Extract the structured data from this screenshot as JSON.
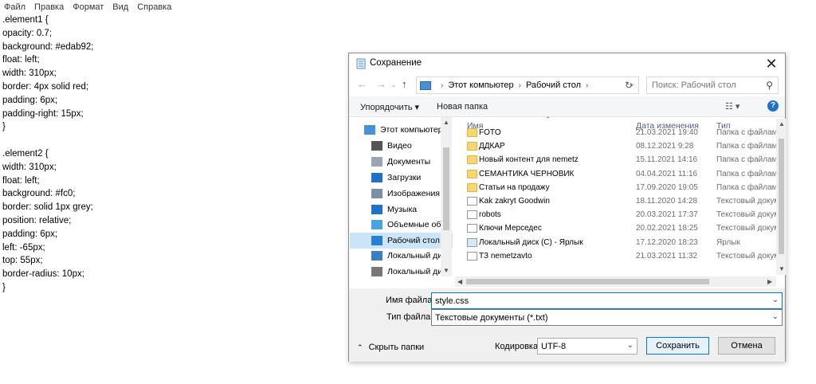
{
  "menubar": [
    "Файл",
    "Правка",
    "Формат",
    "Вид",
    "Справка"
  ],
  "editor": {
    "lines": [
      ".element1 {",
      "opacity: 0.7;",
      "background: #edab92;",
      "float: left;",
      "width: 310px;",
      "border: 4px solid red;",
      "padding: 6px;",
      "padding-right: 15px;",
      "}",
      "",
      ".element2 {",
      "width: 310px;",
      "float: left;",
      "background: #fc0;",
      "border: solid 1px grey;",
      "position: relative;",
      "padding: 6px;",
      "left: -65px;",
      "top: 55px;",
      "border-radius: 10px;",
      "}"
    ]
  },
  "dialog": {
    "title": "Сохранение",
    "breadcrumb": [
      "Этот компьютер",
      "Рабочий стол"
    ],
    "search_placeholder": "Поиск: Рабочий стол",
    "organize_label": "Упорядочить ▾",
    "new_folder_label": "Новая папка",
    "nav_items": [
      {
        "label": "Этот компьютер",
        "icon": "computer-icon",
        "color": "#4a90d9"
      },
      {
        "label": "Видео",
        "icon": "video-icon",
        "color": "#555555"
      },
      {
        "label": "Документы",
        "icon": "documents-icon",
        "color": "#9aa5b1"
      },
      {
        "label": "Загрузки",
        "icon": "downloads-icon",
        "color": "#1e72c9"
      },
      {
        "label": "Изображения",
        "icon": "images-icon",
        "color": "#7c8fa6"
      },
      {
        "label": "Музыка",
        "icon": "music-icon",
        "color": "#1e72c9"
      },
      {
        "label": "Объемные объ",
        "icon": "3d-objects-icon",
        "color": "#4aa3df"
      },
      {
        "label": "Рабочий стол",
        "icon": "desktop-icon",
        "color": "#2b7fd1"
      },
      {
        "label": "Локальный дис",
        "icon": "drive-icon",
        "color": "#3a7fc4"
      },
      {
        "label": "Локальный дис",
        "icon": "drive-icon",
        "color": "#777777"
      }
    ],
    "columns": {
      "name": "Имя",
      "date": "Дата изменения",
      "type": "Тип"
    },
    "files": [
      {
        "name": "FOTO",
        "date": "21.03.2021 19:40",
        "type": "Папка с файлами",
        "kind": "folder"
      },
      {
        "name": "ДДКАР",
        "date": "08.12.2021 9:28",
        "type": "Папка с файлами",
        "kind": "folder"
      },
      {
        "name": "Новый контент для nemetz",
        "date": "15.11.2021 14:16",
        "type": "Папка с файлами",
        "kind": "folder"
      },
      {
        "name": "СЕМАНТИКА ЧЕРНОВИК",
        "date": "04.04.2021 11:16",
        "type": "Папка с файлами",
        "kind": "folder"
      },
      {
        "name": "Статьи на продажу",
        "date": "17.09.2020 19:05",
        "type": "Папка с файлами",
        "kind": "folder"
      },
      {
        "name": "Kak zakryt Goodwin",
        "date": "18.11.2020 14:28",
        "type": "Текстовый докум",
        "kind": "doc"
      },
      {
        "name": "robots",
        "date": "20.03.2021 17:37",
        "type": "Текстовый докум",
        "kind": "doc"
      },
      {
        "name": "Ключи Мерседес",
        "date": "20.02.2021 18:25",
        "type": "Текстовый докум",
        "kind": "doc"
      },
      {
        "name": "Локальный диск (C) - Ярлык",
        "date": "17.12.2020 18:23",
        "type": "Ярлык",
        "kind": "link"
      },
      {
        "name": "ТЗ nemetzavto",
        "date": "21.03.2021 11:32",
        "type": "Текстовый докум",
        "kind": "doc"
      }
    ],
    "filename_label": "Имя файла:",
    "filename_value": "style.css",
    "filetype_label": "Тип файла:",
    "filetype_value": "Текстовые документы (*.txt)",
    "hide_folders_label": "Скрыть папки",
    "encoding_label": "Кодировка:",
    "encoding_value": "UTF-8",
    "save_label": "Сохранить",
    "cancel_label": "Отмена"
  }
}
